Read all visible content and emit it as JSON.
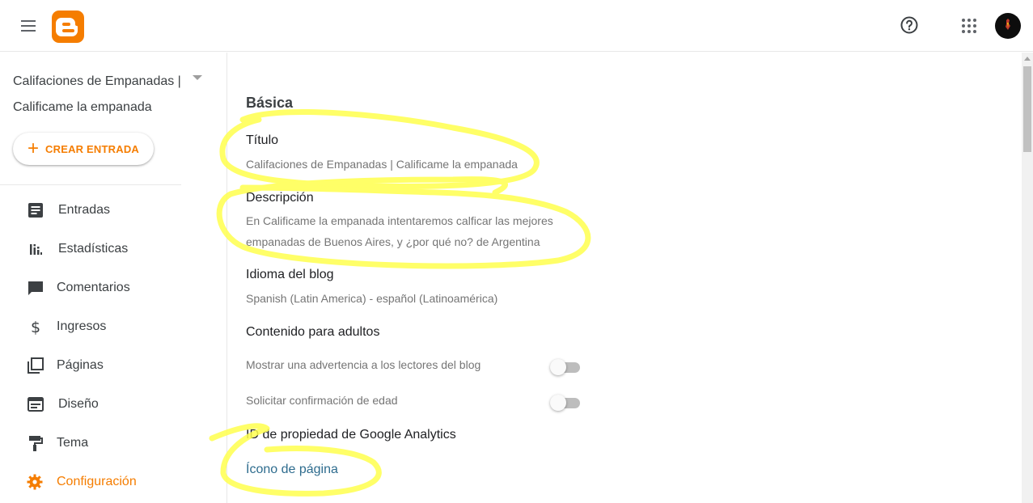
{
  "header": {
    "menu_icon": "hamburger-menu-icon",
    "logo_icon": "blogger-logo-icon",
    "help_icon": "help-circle-icon",
    "apps_icon": "apps-grid-icon",
    "brand_color": "#f57d00"
  },
  "sidebar": {
    "blog_title": "Califaciones de Empanadas | Calificame la empanada",
    "create_button": "CREAR ENTRADA",
    "items": [
      {
        "label": "Entradas",
        "icon": "posts-icon"
      },
      {
        "label": "Estadísticas",
        "icon": "stats-icon"
      },
      {
        "label": "Comentarios",
        "icon": "comments-icon"
      },
      {
        "label": "Ingresos",
        "icon": "dollar-icon"
      },
      {
        "label": "Páginas",
        "icon": "pages-icon"
      },
      {
        "label": "Diseño",
        "icon": "layout-icon"
      },
      {
        "label": "Tema",
        "icon": "theme-roller-icon"
      },
      {
        "label": "Configuración",
        "icon": "gear-icon",
        "active": true
      }
    ]
  },
  "settings": {
    "section_title": "Básica",
    "title_label": "Título",
    "title_value": "Califaciones de Empanadas | Calificame la empanada",
    "description_label": "Descripción",
    "description_value": "En Calificame la empanada intentaremos calficar las mejores empanadas de Buenos Aires, y ¿por qué no? de Argentina",
    "language_label": "Idioma del blog",
    "language_value": "Spanish (Latin America) - español (Latinoamérica)",
    "adult_label": "Contenido para adultos",
    "warning_toggle_label": "Mostrar una advertencia a los lectores del blog",
    "warning_toggle_on": false,
    "age_toggle_label": "Solicitar confirmación de edad",
    "age_toggle_on": false,
    "analytics_label": "ID de propiedad de Google Analytics",
    "favicon_link": "Ícono de página"
  },
  "annotation_color": "#ffff4d"
}
